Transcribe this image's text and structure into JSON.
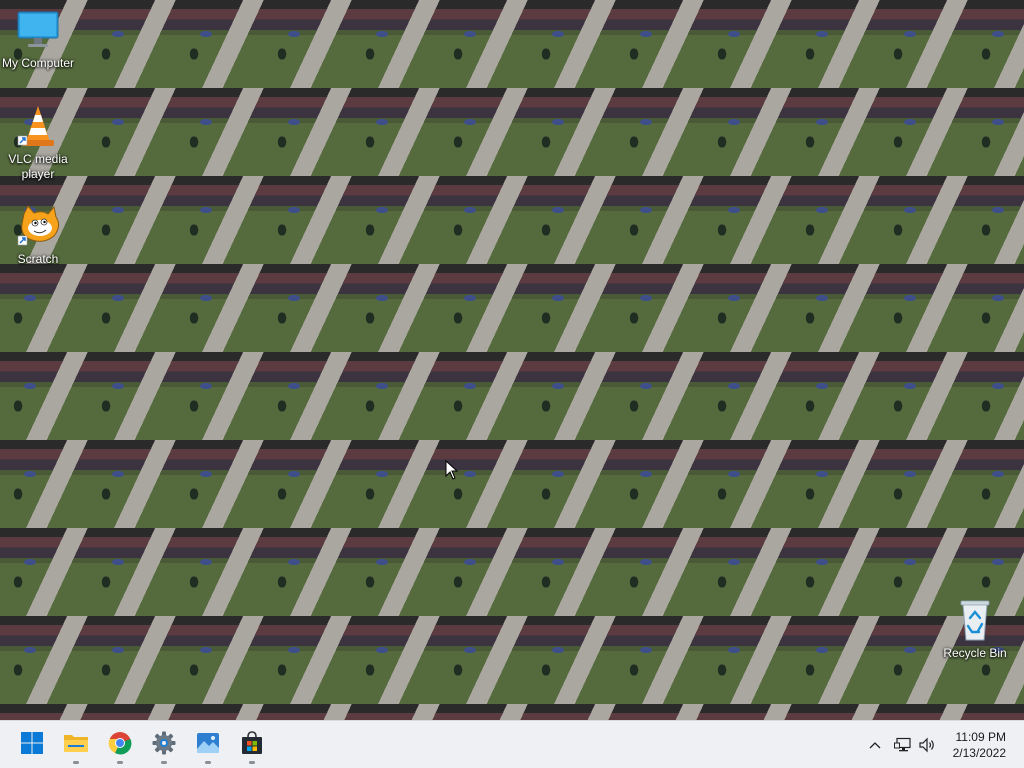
{
  "desktop": {
    "icons": [
      {
        "label": "My Computer",
        "icon": "monitor-icon"
      },
      {
        "label": "VLC media player",
        "icon": "vlc-cone-icon"
      },
      {
        "label": "Scratch",
        "icon": "scratch-cat-icon"
      },
      {
        "label": "Recycle Bin",
        "icon": "recycle-bin-icon"
      }
    ]
  },
  "taskbar": {
    "apps": [
      {
        "name": "Start",
        "icon": "windows-start-icon"
      },
      {
        "name": "File Explorer",
        "icon": "folder-icon"
      },
      {
        "name": "Google Chrome",
        "icon": "chrome-icon"
      },
      {
        "name": "Settings",
        "icon": "gear-icon"
      },
      {
        "name": "Photos",
        "icon": "photos-icon"
      },
      {
        "name": "Microsoft Store",
        "icon": "store-bag-icon"
      }
    ],
    "tray": {
      "icons": [
        "chevron-up-icon",
        "network-icon",
        "volume-icon"
      ]
    },
    "clock": {
      "time": "11:09 PM",
      "date": "2/13/2022"
    }
  },
  "colors": {
    "taskbar_bg": "#eef0f3",
    "accent_blue": "#0078d4"
  }
}
